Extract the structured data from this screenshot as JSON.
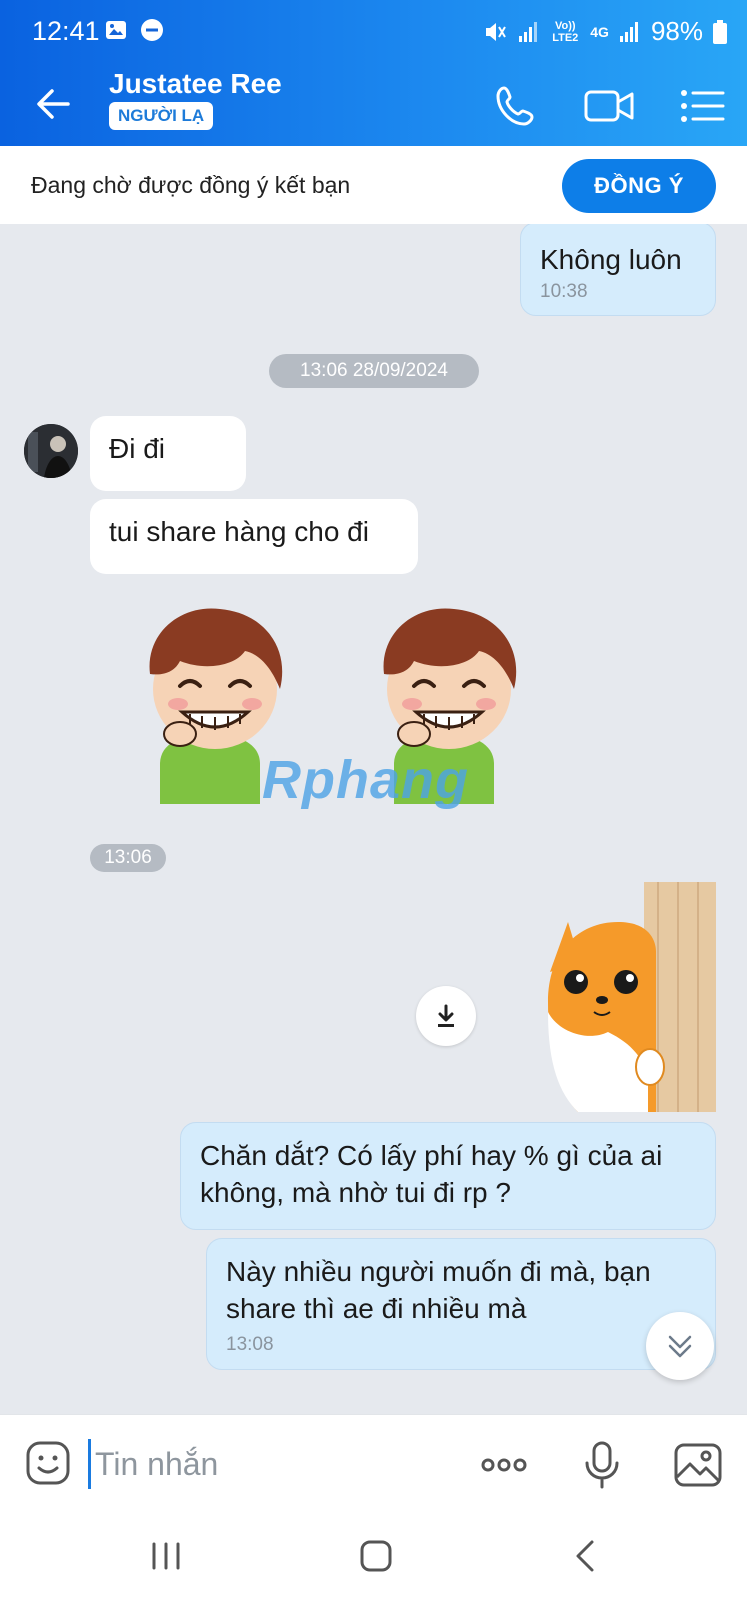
{
  "status_bar": {
    "time": "12:41",
    "network_label_1": "Vo)) LTE2",
    "network_label_2": "4G",
    "battery": "98%"
  },
  "header": {
    "contact_name": "Justatee Ree",
    "badge": "NGƯỜI LẠ",
    "back_icon": "arrow-left-icon",
    "call_icon": "phone-icon",
    "video_icon": "video-camera-icon",
    "menu_icon": "list-menu-icon"
  },
  "friend_request": {
    "text": "Đang chờ được đồng ý kết bạn",
    "accept_label": "ĐỒNG Ý"
  },
  "messages": {
    "m1": {
      "text": "Không luôn",
      "time": "10:38"
    },
    "date_divider": "13:06 28/09/2024",
    "m2": {
      "text": "Đi đi"
    },
    "m3": {
      "text": "tui share hàng cho đi"
    },
    "sticker_time": "13:06",
    "m5": {
      "text": "Chăn dắt? Có lấy phí hay % gì của ai không, mà nhờ tui đi rp ?"
    },
    "m6": {
      "text": "Này nhiều người muốn đi mà, bạn share thì ae đi nhiều mà",
      "time": "13:08"
    }
  },
  "watermark": "Rphang",
  "input_bar": {
    "placeholder": "Tin nhắn",
    "emoji_icon": "emoji-icon",
    "more_icon": "more-dots-icon",
    "mic_icon": "microphone-icon",
    "image_icon": "image-icon"
  },
  "colors": {
    "accent": "#0d7ee8",
    "header_start": "#0a62e0",
    "header_end": "#29a6f6",
    "outgoing_bubble": "#d5ecfc",
    "chat_bg": "#e6e9ee"
  }
}
